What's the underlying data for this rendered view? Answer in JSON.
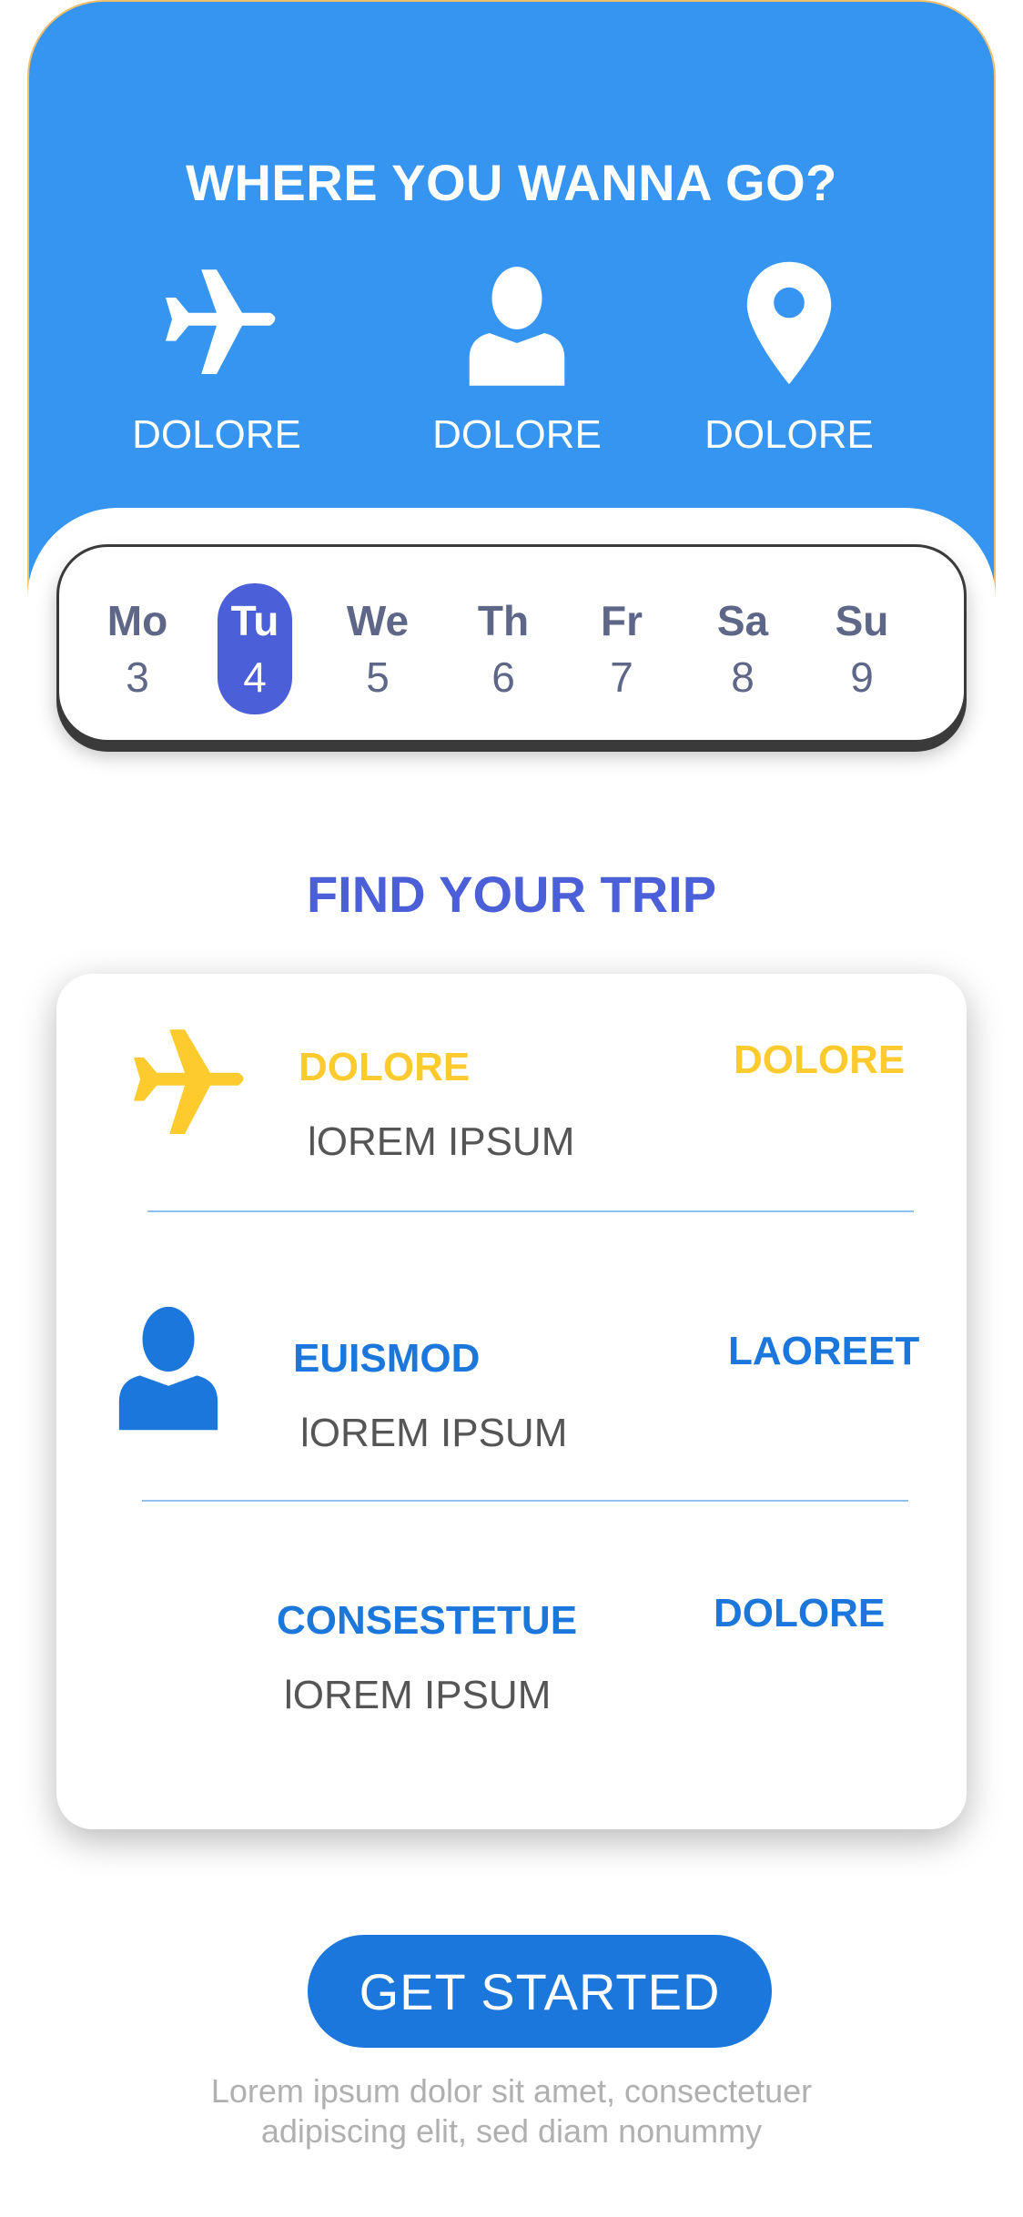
{
  "hero": {
    "title": "WHERE YOU WANNA GO?",
    "categories": [
      {
        "icon": "airplane-icon",
        "label": "DOLORE"
      },
      {
        "icon": "person-icon",
        "label": "DOLORE"
      },
      {
        "icon": "map-pin-icon",
        "label": "DOLORE"
      }
    ]
  },
  "week": {
    "days": [
      {
        "name": "Mo",
        "num": "3"
      },
      {
        "name": "Tu",
        "num": "4"
      },
      {
        "name": "We",
        "num": "5"
      },
      {
        "name": "Th",
        "num": "6"
      },
      {
        "name": "Fr",
        "num": "7"
      },
      {
        "name": "Sa",
        "num": "8"
      },
      {
        "name": "Su",
        "num": "9"
      }
    ],
    "selected": "Tu"
  },
  "trips": {
    "title": "FIND YOUR TRIP",
    "rows": [
      {
        "icon": "airplane-icon",
        "title": "DOLORE",
        "subtitle": "lOREM IPSUM",
        "right": "DOLORE",
        "color": "#fecb2f"
      },
      {
        "icon": "person-icon",
        "title": "EUISMOD",
        "subtitle": "lOREM IPSUM",
        "right": "LAOREET",
        "color": "#1c77dc"
      },
      {
        "icon": "",
        "title": "CONSESTETUE",
        "subtitle": "lOREM IPSUM",
        "right": "DOLORE",
        "color": "#1c77dc"
      }
    ]
  },
  "cta": {
    "label": "GET STARTED"
  },
  "footer": {
    "line1": "Lorem ipsum dolor sit amet, consectetuer",
    "line2": "adipiscing elit, sed diam nonummy"
  },
  "colors": {
    "hero_bg": "#3595f0",
    "accent": "#4b5fd8",
    "yellow": "#fecb2f",
    "blue": "#1c77dc"
  }
}
